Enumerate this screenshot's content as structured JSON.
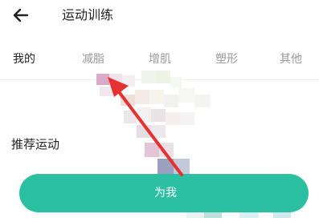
{
  "header": {
    "back_icon": "arrow-left-icon",
    "title": "运动训练"
  },
  "tabs": [
    {
      "label": "我的",
      "active": true
    },
    {
      "label": "减脂",
      "active": false
    },
    {
      "label": "增肌",
      "active": false
    },
    {
      "label": "塑形",
      "active": false
    },
    {
      "label": "其他",
      "active": false
    }
  ],
  "section": {
    "title": "推荐运动"
  },
  "cta": {
    "label": "为我"
  },
  "colors": {
    "accent": "#2ac0a1",
    "annotation_arrow": "#e5312f",
    "inactive_tab": "#999999",
    "active_tab": "#222222"
  }
}
